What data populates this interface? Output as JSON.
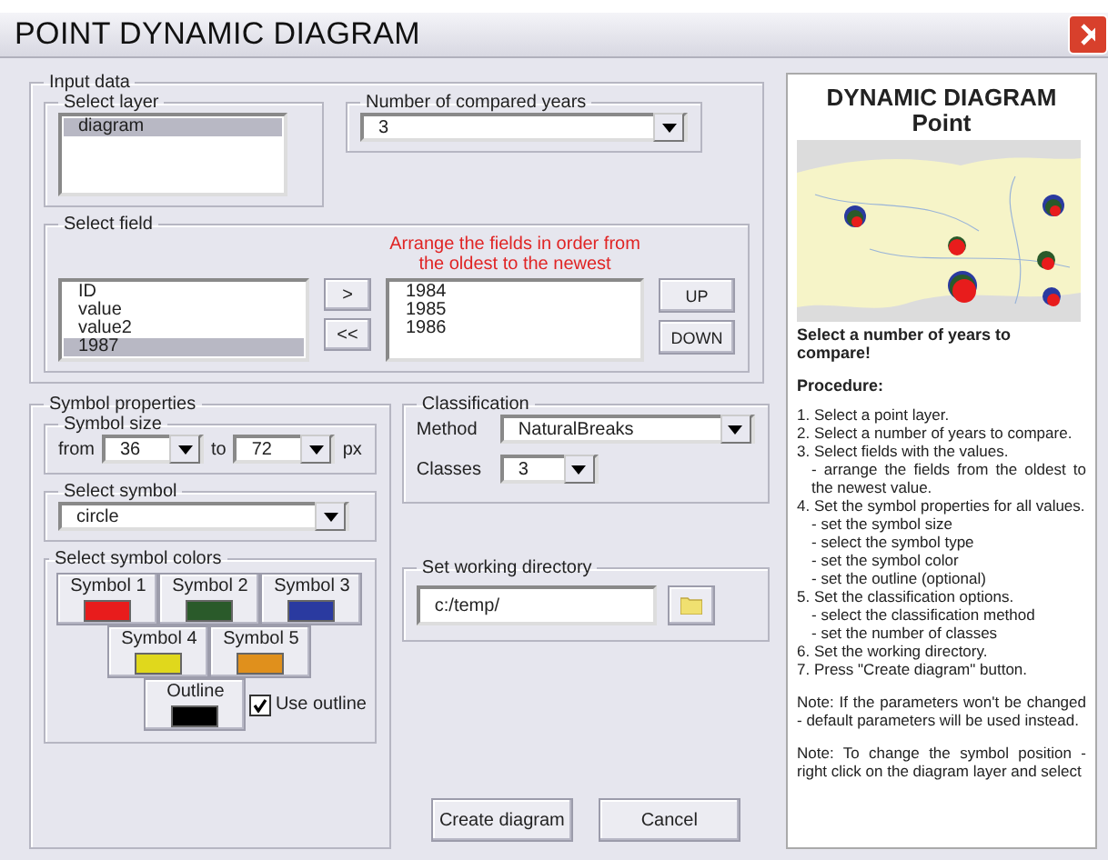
{
  "window": {
    "title": "POINT DYNAMIC DIAGRAM"
  },
  "input_data": {
    "label": "Input data",
    "select_layer": {
      "label": "Select layer",
      "items": [
        {
          "text": "diagram",
          "selected": true
        }
      ]
    },
    "years": {
      "label": "Number of compared years",
      "value": "3"
    },
    "select_field": {
      "label": "Select field",
      "hint": "Arrange the fields in order from the oldest to the newest",
      "fields": [
        {
          "text": "ID",
          "selected": false
        },
        {
          "text": "value",
          "selected": false
        },
        {
          "text": "value2",
          "selected": false
        },
        {
          "text": "1987",
          "selected": true
        }
      ],
      "add_button": ">",
      "remove_button": "<<",
      "chosen": [
        {
          "text": "1984",
          "selected": false
        },
        {
          "text": "1985",
          "selected": false
        },
        {
          "text": "1986",
          "selected": false
        }
      ],
      "up_button": "UP",
      "down_button": "DOWN"
    }
  },
  "symbol_properties": {
    "label": "Symbol properties",
    "size": {
      "label": "Symbol size",
      "from_label": "from",
      "from": "36",
      "to_label": "to",
      "to": "72",
      "unit": "px"
    },
    "symbol": {
      "label": "Select symbol",
      "value": "circle"
    },
    "colors": {
      "label": "Select symbol colors",
      "symbols": [
        {
          "label": "Symbol 1",
          "color": "#e81c1c"
        },
        {
          "label": "Symbol 2",
          "color": "#2a5a2a"
        },
        {
          "label": "Symbol 3",
          "color": "#2a3aa0"
        },
        {
          "label": "Symbol 4",
          "color": "#e0d81c"
        },
        {
          "label": "Symbol 5",
          "color": "#e0901c"
        }
      ],
      "outline": {
        "label": "Outline",
        "color": "#000000"
      },
      "use_outline": {
        "label": "Use outline",
        "checked": true
      }
    }
  },
  "classification": {
    "label": "Classification",
    "method_label": "Method",
    "method": "NaturalBreaks",
    "classes_label": "Classes",
    "classes": "3"
  },
  "working_directory": {
    "label": "Set working directory",
    "value": "c:/temp/"
  },
  "buttons": [
    "Create diagram",
    "Cancel"
  ],
  "help": {
    "title": [
      "DYNAMIC DIAGRAM",
      "Point"
    ],
    "headline": "Select a number of years to compare!",
    "procedure": "Procedure:",
    "steps": [
      {
        "text": "1. Select a point layer."
      },
      {
        "text": "2. Select a number of years to compare."
      },
      {
        "text": "3. Select fields with the values.",
        "children": [
          "- arrange the fields from the oldest to the newest value."
        ]
      },
      {
        "text": "4. Set the symbol properties for all values.",
        "children": [
          "- set the symbol size",
          "- select the symbol type",
          "- set the symbol color",
          "- set the outline (optional)"
        ]
      },
      {
        "text": "5. Set the classification options.",
        "children": [
          "- select the classification method",
          "- set the number of classes"
        ]
      },
      {
        "text": "6. Set the working directory."
      },
      {
        "text": "7. Press \"Create diagram\" button."
      }
    ],
    "notes": [
      "Note: If the parameters won't be changed - default parameters will be used instead.",
      "Note: To change the symbol position - right click on the diagram layer and select"
    ]
  }
}
